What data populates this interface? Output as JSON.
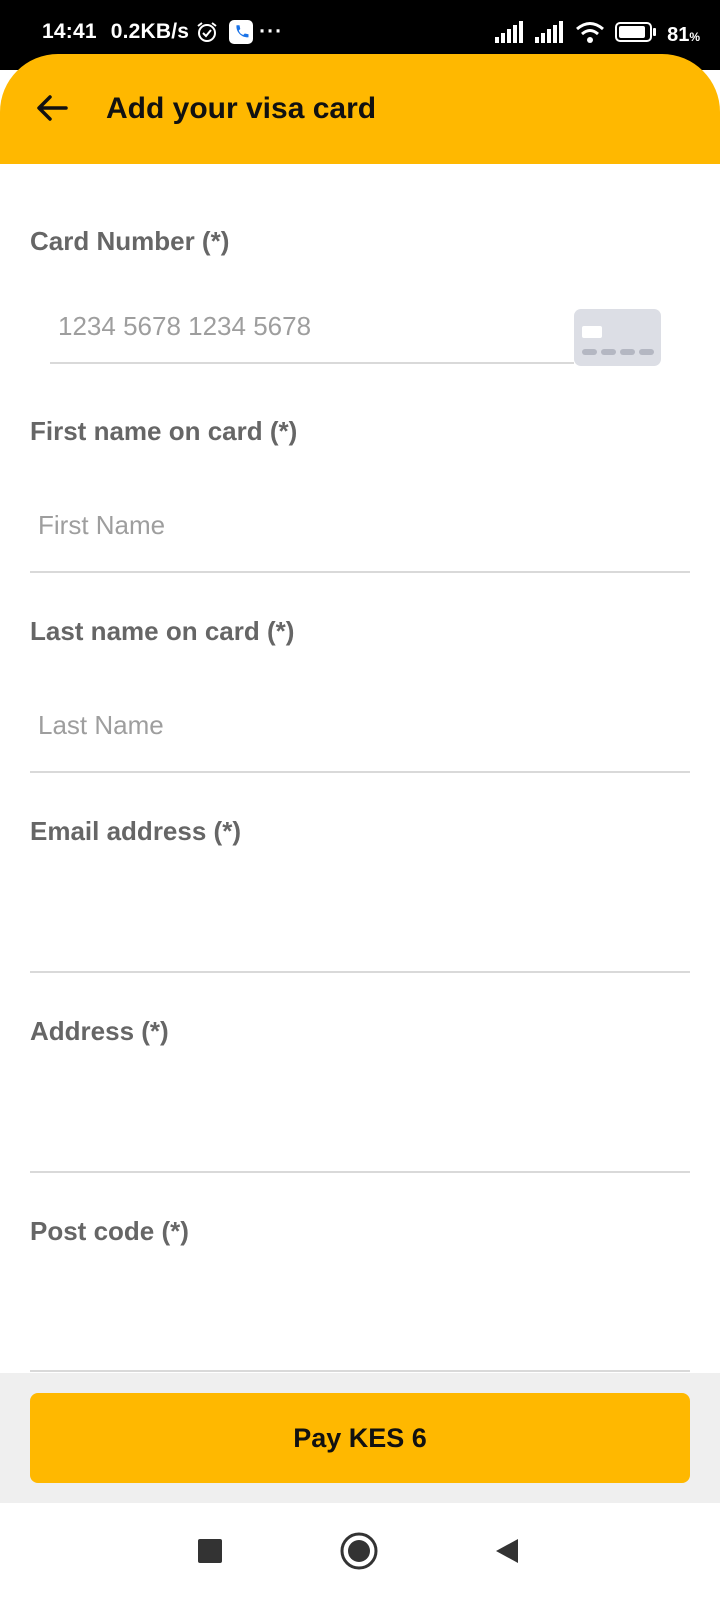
{
  "status_bar": {
    "time": "14:41",
    "network_speed": "0.2KB/s",
    "more": "···",
    "battery_percent": "81",
    "battery_unit": "%"
  },
  "header": {
    "title": "Add your visa card",
    "back_icon": "arrow-left-icon",
    "background_color": "#ffb800"
  },
  "form": {
    "card_number": {
      "label": "Card Number (*)",
      "placeholder": "1234 5678 1234 5678",
      "value": "",
      "icon": "credit-card-icon"
    },
    "first_name": {
      "label": "First name on card (*)",
      "placeholder": "First Name",
      "value": ""
    },
    "last_name": {
      "label": "Last name on card (*)",
      "placeholder": "Last Name",
      "value": ""
    },
    "email": {
      "label": "Email address (*)",
      "placeholder": "",
      "value": ""
    },
    "address": {
      "label": "Address (*)",
      "placeholder": "",
      "value": ""
    },
    "post_code": {
      "label": "Post code (*)",
      "placeholder": "",
      "value": ""
    }
  },
  "pay_button": {
    "label": "Pay KES 6"
  },
  "nav_bar": {
    "icons": [
      "recents-square-icon",
      "home-circle-icon",
      "back-triangle-icon"
    ]
  }
}
